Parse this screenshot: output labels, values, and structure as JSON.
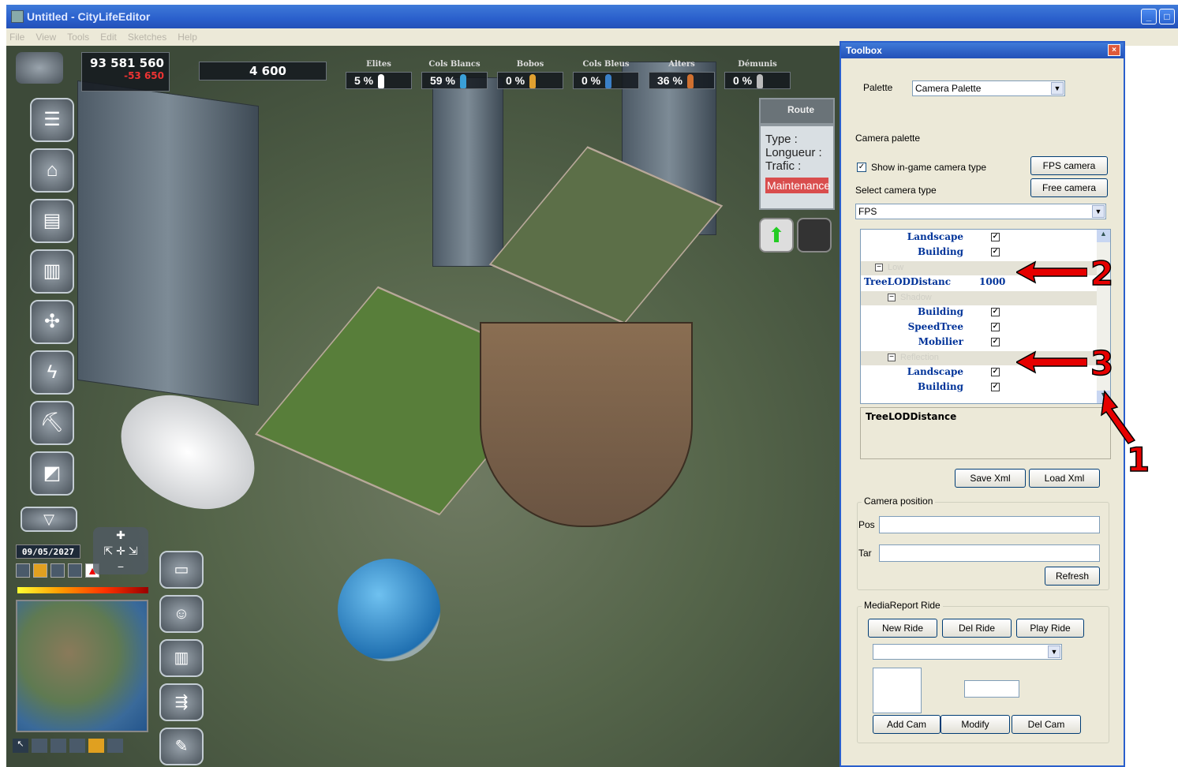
{
  "window": {
    "title": "Untitled - CityLifeEditor",
    "menu": [
      "File",
      "View",
      "Tools",
      "Edit",
      "Sketches",
      "Help"
    ]
  },
  "hud": {
    "money": "93 581 560",
    "money_delta": "-53 650",
    "population": "4 600",
    "classes": [
      {
        "label": "Elites",
        "pct": "5 %",
        "color": "#ffffff"
      },
      {
        "label": "Cols Blancs",
        "pct": "59 %",
        "color": "#3aa0d8"
      },
      {
        "label": "Bobos",
        "pct": "0 %",
        "color": "#e0a030"
      },
      {
        "label": "Cols Bleus",
        "pct": "0 %",
        "color": "#3a80c8"
      },
      {
        "label": "Alters",
        "pct": "36 %",
        "color": "#d07030"
      },
      {
        "label": "Démunis",
        "pct": "0 %",
        "color": "#bbbbbb"
      }
    ],
    "date": "09/05/2027",
    "colorbar_value": "0"
  },
  "route_panel": {
    "title": "Route",
    "type_label": "Type :",
    "length_label": "Longueur :",
    "traffic_label": "Trafic :",
    "maintenance": "Maintenance"
  },
  "toolbox": {
    "title": "Toolbox",
    "palette_label": "Palette",
    "palette_value": "Camera Palette",
    "section_title": "Camera palette",
    "show_camera_type": "Show in-game camera type",
    "fps_camera_button": "FPS camera",
    "free_camera_button": "Free camera",
    "select_camera_label": "Select camera type",
    "camera_type_value": "FPS",
    "grid": {
      "rows": [
        {
          "name": "Landscape",
          "checked": true
        },
        {
          "name": "Building",
          "checked": true
        },
        {
          "category": "Low"
        },
        {
          "name": "TreeLODDistanc",
          "value": "1000"
        },
        {
          "category": "Shadow"
        },
        {
          "name": "Building",
          "checked": true
        },
        {
          "name": "SpeedTree",
          "checked": true
        },
        {
          "name": "Mobilier",
          "checked": true
        },
        {
          "category": "Reflection"
        },
        {
          "name": "Landscape",
          "checked": true
        },
        {
          "name": "Building",
          "checked": true
        }
      ]
    },
    "description": "TreeLODDistance",
    "save_xml": "Save Xml",
    "load_xml": "Load Xml",
    "camera_position": {
      "label": "Camera position",
      "pos_label": "Pos",
      "tar_label": "Tar",
      "refresh": "Refresh"
    },
    "media_report": {
      "label": "MediaReport Ride",
      "new_ride": "New Ride",
      "del_ride": "Del Ride",
      "play_ride": "Play Ride",
      "add_cam": "Add Cam",
      "modify": "Modify",
      "del_cam": "Del Cam"
    }
  },
  "annotations": [
    "1",
    "2",
    "3"
  ]
}
